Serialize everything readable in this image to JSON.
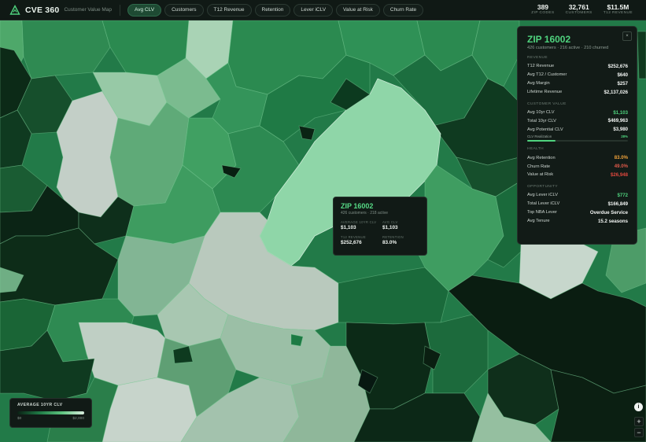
{
  "app": {
    "brand": "CVE 360",
    "subtitle": "Customer Value Map"
  },
  "tabs": [
    {
      "label": "Avg CLV",
      "active": true
    },
    {
      "label": "Customers",
      "active": false
    },
    {
      "label": "T12 Revenue",
      "active": false
    },
    {
      "label": "Retention",
      "active": false
    },
    {
      "label": "Lever iCLV",
      "active": false
    },
    {
      "label": "Value at Risk",
      "active": false
    },
    {
      "label": "Churn Rate",
      "active": false
    }
  ],
  "stats": [
    {
      "value": "389",
      "label": "ZIP CODES"
    },
    {
      "value": "32,761",
      "label": "CUSTOMERS"
    },
    {
      "value": "$11.5M",
      "label": "T12 REVENUE"
    }
  ],
  "tooltip": {
    "title": "ZIP 16002",
    "subtitle": "426 customers · 218 active",
    "fields": [
      {
        "label": "AVERAGE 10YR CLV",
        "value": "$1,103"
      },
      {
        "label": "AVG CLV",
        "value": "$1,103"
      },
      {
        "label": "T12 REVENUE",
        "value": "$252,676"
      },
      {
        "label": "RETENTION",
        "value": "83.0%"
      }
    ]
  },
  "panel": {
    "title": "ZIP 16002",
    "subtitle": "426 customers · 216 active · 210 churned",
    "close_glyph": "×",
    "sections": {
      "revenue": {
        "heading": "REVENUE",
        "rows": [
          {
            "label": "T12 Revenue",
            "value": "$252,676"
          },
          {
            "label": "Avg T12 / Customer",
            "value": "$640"
          },
          {
            "label": "Avg Margin",
            "value": "$257"
          },
          {
            "label": "Lifetime Revenue",
            "value": "$2,137,026"
          }
        ]
      },
      "customer_value": {
        "heading": "CUSTOMER VALUE",
        "rows": [
          {
            "label": "Avg 10yr CLV",
            "value": "$1,103"
          },
          {
            "label": "Total 10yr CLV",
            "value": "$469,963"
          },
          {
            "label": "Avg Potential CLV",
            "value": "$3,980"
          }
        ],
        "realization_label": "CLV Realization",
        "realization_pct": "28%",
        "realization_fraction": 0.28
      },
      "health": {
        "heading": "HEALTH",
        "rows": [
          {
            "label": "Avg Retention",
            "value": "83.0%"
          },
          {
            "label": "Churn Rate",
            "value": "49.0%"
          },
          {
            "label": "Value at Risk",
            "value": "$26,948"
          }
        ]
      },
      "opportunity": {
        "heading": "OPPORTUNITY",
        "rows": [
          {
            "label": "Avg Lever iCLV",
            "value": "$772"
          },
          {
            "label": "Total Lever iCLV",
            "value": "$166,849"
          },
          {
            "label": "Top NBA Lever",
            "value": "Overdue Service"
          },
          {
            "label": "Avg Tenure",
            "value": "15.2 seasons"
          }
        ]
      }
    }
  },
  "legend": {
    "title": "AVERAGE 10YR CLV",
    "min": "$0",
    "max": "$2,000"
  },
  "controls": {
    "info": "i",
    "zoom_in": "+",
    "zoom_out": "−"
  },
  "colors": {
    "accent": "#4fd37e",
    "selected_zip_fill": "#8fd6a8"
  }
}
